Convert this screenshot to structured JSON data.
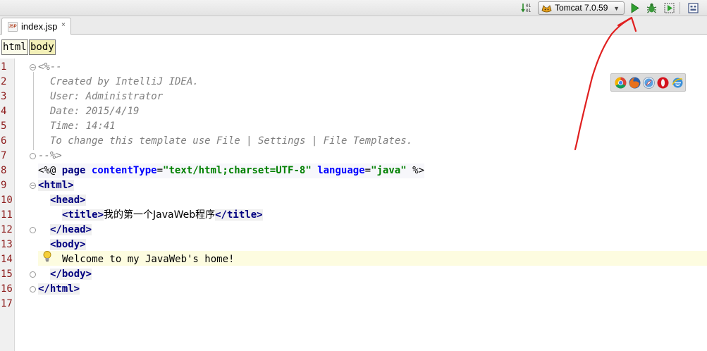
{
  "toolbar": {
    "run_config": "Tomcat 7.0.59",
    "icons": {
      "sort": "sort-numeric-icon",
      "tomcat": "tomcat-cat-icon",
      "run": "run-icon",
      "debug": "debug-icon",
      "coverage": "run-with-coverage-icon",
      "structure": "structure-icon"
    }
  },
  "tabs": [
    {
      "label": "index.jsp",
      "icon": "jsp-file-icon",
      "close": "×",
      "icon_text": "JSP"
    }
  ],
  "breadcrumb": [
    "html",
    "body"
  ],
  "editor": {
    "line_numbers": [
      "1",
      "2",
      "3",
      "4",
      "5",
      "6",
      "7",
      "8",
      "9",
      "10",
      "11",
      "12",
      "13",
      "14",
      "15",
      "16",
      "17"
    ],
    "lines": {
      "l1": "<%--",
      "l2": "Created by IntelliJ IDEA.",
      "l3": "User: Administrator",
      "l4": "Date: 2015/4/19",
      "l5": "Time: 14:41",
      "l6": "To change this template use File | Settings | File Templates.",
      "l7": "--%>",
      "l8": {
        "open": "<%@",
        "directive": "page",
        "attr1": "contentType",
        "val1": "\"text/html;charset=UTF-8\"",
        "attr2": "language",
        "val2": "\"java\"",
        "close": "%>"
      },
      "l9": "<html>",
      "l10": "<head>",
      "l11": {
        "open": "<title>",
        "text": "我的第一个JavaWeb程序",
        "close": "</title>"
      },
      "l12": "</head>",
      "l13": "<body>",
      "l14": "Welcome to my JavaWeb's home!",
      "l15": "</body>",
      "l16": "</html>"
    },
    "current_line": 14,
    "intention_icon": "lightbulb-icon"
  },
  "browser_popup": {
    "icons": [
      "chrome-icon",
      "firefox-icon",
      "safari-icon",
      "opera-icon",
      "ie-icon"
    ]
  },
  "colors": {
    "comment": "#808080",
    "tag": "#000080",
    "attribute": "#0000ff",
    "string": "#008000",
    "caret_row": "#fdfce0",
    "annotation": "#e02020"
  }
}
